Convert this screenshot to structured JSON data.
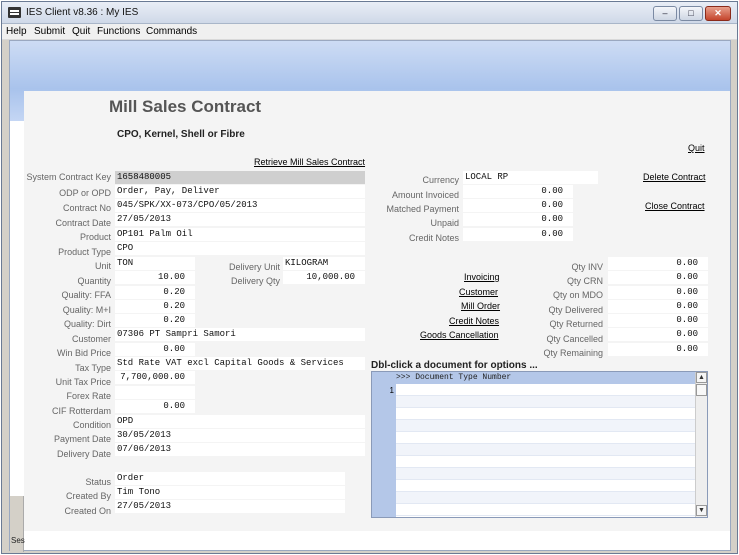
{
  "window": {
    "title": "IES Client v8.36 : My IES",
    "min": "‒",
    "max": "□",
    "close": "✕"
  },
  "menu": [
    "Help",
    "Submit",
    "Quit",
    "Functions",
    "Commands"
  ],
  "page": {
    "title": "Mill Sales Contract",
    "subtitle": "CPO, Kernel, Shell or Fibre"
  },
  "links": {
    "quit": "Quit",
    "retrieve": "Retrieve Mill Sales Contract",
    "delete": "Delete Contract",
    "close": "Close Contract",
    "invoicing": "Invoicing",
    "customer": "Customer",
    "mill_order": "Mill Order",
    "credit_notes": "Credit Notes",
    "goods_cancellation": "Goods Cancellation"
  },
  "left_fields": [
    {
      "label": "System Contract Key",
      "value": "1658480005"
    },
    {
      "label": "ODP or OPD",
      "value": "Order, Pay, Deliver"
    },
    {
      "label": "Contract No",
      "value": "045/SPK/XX-073/CPO/05/2013"
    },
    {
      "label": "Contract Date",
      "value": "27/05/2013"
    },
    {
      "label": "Product",
      "value": "OP101 Palm Oil"
    },
    {
      "label": "Product Type",
      "value": "CPO"
    },
    {
      "label": "Unit",
      "value": "TON"
    },
    {
      "label": "Quantity",
      "value": "10.00"
    },
    {
      "label": "Quality: FFA",
      "value": "0.20"
    },
    {
      "label": "Quality: M+I",
      "value": "0.20"
    },
    {
      "label": "Quality: Dirt",
      "value": "0.20"
    },
    {
      "label": "Customer",
      "value": "07306 PT Sampri Samori"
    },
    {
      "label": "Win Bid Price",
      "value": "0.00"
    },
    {
      "label": "Tax Type",
      "value": "Std Rate VAT excl Capital Goods & Services"
    },
    {
      "label": "Unit Tax Price",
      "value": "7,700,000.00"
    },
    {
      "label": "Forex Rate",
      "value": ""
    },
    {
      "label": "CIF Rotterdam",
      "value": "0.00"
    },
    {
      "label": "Condition",
      "value": "OPD"
    },
    {
      "label": "Payment Date",
      "value": "30/05/2013"
    },
    {
      "label": "Delivery Date",
      "value": "07/06/2013"
    }
  ],
  "delivery": {
    "unit_label": "Delivery Unit",
    "unit_value": "KILOGRAM",
    "qty_label": "Delivery Qty",
    "qty_value": "10,000.00"
  },
  "status_fields": [
    {
      "label": "Status",
      "value": "Order"
    },
    {
      "label": "Created By",
      "value": "Tim Tono"
    },
    {
      "label": "Created On",
      "value": "27/05/2013"
    }
  ],
  "right_fields": [
    {
      "label": "Currency",
      "value": "LOCAL RP"
    },
    {
      "label": "Amount Invoiced",
      "value": "0.00"
    },
    {
      "label": "Matched Payment",
      "value": "0.00"
    },
    {
      "label": "Unpaid",
      "value": "0.00"
    },
    {
      "label": "Credit Notes",
      "value": "0.00"
    }
  ],
  "qty_fields": [
    {
      "label": "Qty INV",
      "value": "0.00"
    },
    {
      "label": "Qty CRN",
      "value": "0.00"
    },
    {
      "label": "Qty on MDO",
      "value": "0.00"
    },
    {
      "label": "Qty Delivered",
      "value": "0.00"
    },
    {
      "label": "Qty Returned",
      "value": "0.00"
    },
    {
      "label": "Qty Cancelled",
      "value": "0.00"
    },
    {
      "label": "Qty Remaining",
      "value": "0.00"
    }
  ],
  "documents": {
    "header": "Dbl-click a document for options ...",
    "columns": ">>> Document Type        Number",
    "row_numbers": [
      "1"
    ],
    "scroll_up": "▲",
    "scroll_down": "▼"
  },
  "session_label": "Ses"
}
